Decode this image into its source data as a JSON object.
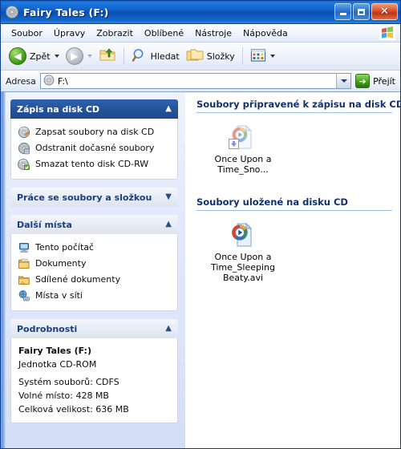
{
  "window": {
    "title": "Fairy Tales (F:)",
    "icon": "cd-drive-icon",
    "controls": {
      "minimize": "_",
      "maximize": "□",
      "close": "✕"
    }
  },
  "menu": {
    "items": [
      {
        "label": "Soubor"
      },
      {
        "label": "Úpravy"
      },
      {
        "label": "Zobrazit"
      },
      {
        "label": "Oblíbené"
      },
      {
        "label": "Nástroje"
      },
      {
        "label": "Nápověda"
      }
    ]
  },
  "toolbar": {
    "back_label": "Zpět",
    "forward_label": "",
    "up_label": "",
    "search_label": "Hledat",
    "folders_label": "Složky",
    "views_label": ""
  },
  "address": {
    "label": "Adresa",
    "value": "F:\\",
    "placeholder": "F:\\",
    "go_label": "Přejít",
    "go_icon": "➔"
  },
  "sidebar": {
    "panels": [
      {
        "title": "Zápis na disk CD",
        "style": "blue",
        "chevron": "collapse",
        "items": [
          {
            "label": "Zapsat soubory na disk CD",
            "icon": "burn-cd-icon"
          },
          {
            "label": "Odstranit dočasné soubory",
            "icon": "delete-temp-icon"
          },
          {
            "label": "Smazat tento disk CD-RW",
            "icon": "erase-cdrw-icon"
          }
        ]
      },
      {
        "title": "Práce se soubory a složkou",
        "style": "gray",
        "chevron": "expand",
        "items": []
      },
      {
        "title": "Další místa",
        "style": "gray",
        "chevron": "collapse",
        "items": [
          {
            "label": "Tento počítač",
            "icon": "my-computer-icon"
          },
          {
            "label": "Dokumenty",
            "icon": "documents-folder-icon"
          },
          {
            "label": "Sdílené dokumenty",
            "icon": "shared-documents-icon"
          },
          {
            "label": "Místa v síti",
            "icon": "network-places-icon"
          }
        ]
      },
      {
        "title": "Podrobnosti",
        "style": "gray",
        "chevron": "collapse",
        "details": [
          {
            "text": "Fairy Tales (F:)",
            "bold": true
          },
          {
            "text": "Jednotka CD-ROM",
            "bold": false
          },
          {
            "text": "Systém souborů: CDFS",
            "bold": false
          },
          {
            "text": "Volné místo: 428 MB",
            "bold": false
          },
          {
            "text": "Celková velikost: 636 MB",
            "bold": false
          }
        ]
      }
    ]
  },
  "content": {
    "groups": [
      {
        "title": "Soubory připravené k zápisu na disk CD",
        "files": [
          {
            "name": "Once Upon a Time_Sno...",
            "icon": "media-file-icon",
            "pending": true
          }
        ]
      },
      {
        "title": "Soubory uložené na disku CD",
        "files": [
          {
            "name": "Once Upon a Time_Sleeping Beaty.avi",
            "icon": "media-file-icon",
            "pending": false
          }
        ]
      }
    ]
  },
  "colors": {
    "titlebar_blue": "#1461c8",
    "panel_header_blue": "#24539a",
    "group_title": "#12316b",
    "sidebar_bg": "#dbe4f9",
    "close_red": "#d9502a",
    "accent_green": "#3f9a14"
  }
}
